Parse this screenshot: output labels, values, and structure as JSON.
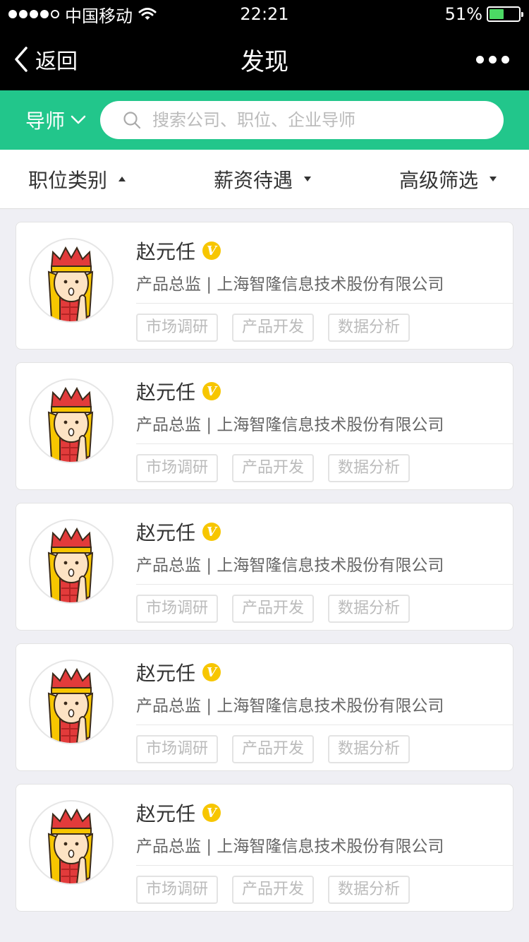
{
  "status_bar": {
    "carrier": "中国移动",
    "time": "22:21",
    "battery_pct": "51%",
    "battery_level": 0.51,
    "signal_dots_filled": 4,
    "wifi_icon": "wifi-icon"
  },
  "nav": {
    "back_label": "返回",
    "title": "发现",
    "more_icon": "more-dots-icon"
  },
  "search": {
    "category_label": "导师",
    "placeholder": "搜索公司、职位、企业导师",
    "value": ""
  },
  "filters": [
    {
      "label": "职位类别",
      "arrow": "up"
    },
    {
      "label": "薪资待遇",
      "arrow": "down"
    },
    {
      "label": "高级筛选",
      "arrow": "down"
    }
  ],
  "colors": {
    "accent": "#22c68b",
    "badge": "#f7c600",
    "battery": "#4cd964"
  },
  "mentors": [
    {
      "name": "赵元任",
      "badge": "V",
      "title": "产品总监",
      "company": "上海智隆信息技术股份有限公司",
      "tags": [
        "市场调研",
        "产品开发",
        "数据分析"
      ]
    },
    {
      "name": "赵元任",
      "badge": "V",
      "title": "产品总监",
      "company": "上海智隆信息技术股份有限公司",
      "tags": [
        "市场调研",
        "产品开发",
        "数据分析"
      ]
    },
    {
      "name": "赵元任",
      "badge": "V",
      "title": "产品总监",
      "company": "上海智隆信息技术股份有限公司",
      "tags": [
        "市场调研",
        "产品开发",
        "数据分析"
      ]
    },
    {
      "name": "赵元任",
      "badge": "V",
      "title": "产品总监",
      "company": "上海智隆信息技术股份有限公司",
      "tags": [
        "市场调研",
        "产品开发",
        "数据分析"
      ]
    },
    {
      "name": "赵元任",
      "badge": "V",
      "title": "产品总监",
      "company": "上海智隆信息技术股份有限公司",
      "tags": [
        "市场调研",
        "产品开发",
        "数据分析"
      ]
    }
  ]
}
